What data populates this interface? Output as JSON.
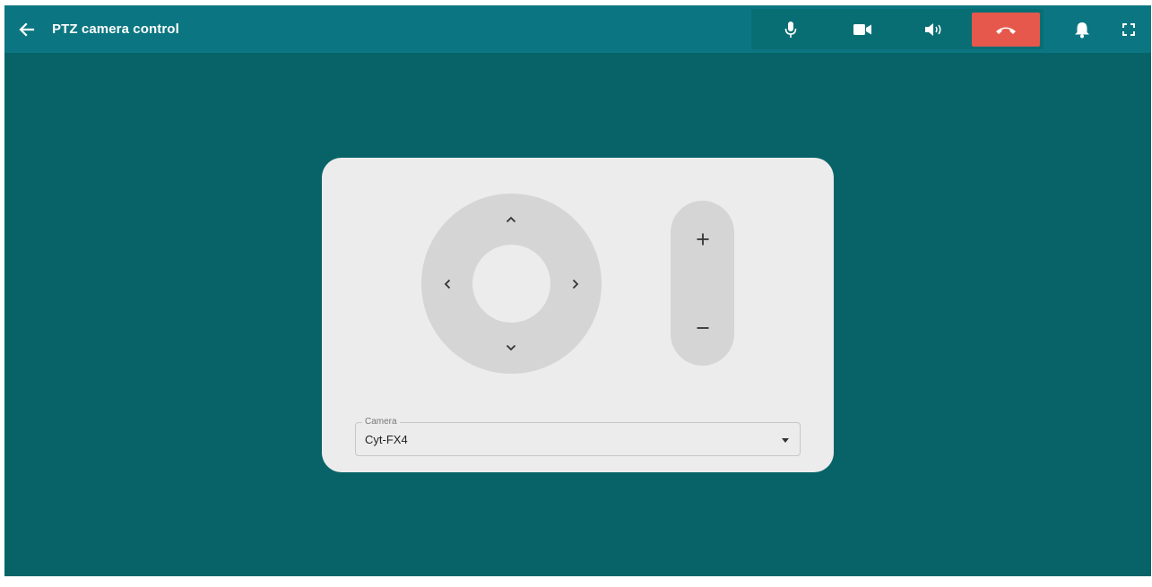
{
  "header": {
    "title": "PTZ camera control",
    "back_icon": "arrow-left-icon"
  },
  "call_controls": {
    "items": [
      {
        "name": "microphone",
        "icon": "microphone-icon"
      },
      {
        "name": "camera",
        "icon": "video-camera-icon"
      },
      {
        "name": "speaker",
        "icon": "speaker-icon"
      },
      {
        "name": "hang-up",
        "icon": "phone-hangup-icon",
        "color": "#e5584b"
      }
    ]
  },
  "toolbar_right": {
    "items": [
      {
        "name": "notifications",
        "icon": "bell-icon"
      },
      {
        "name": "fullscreen",
        "icon": "fullscreen-icon"
      }
    ]
  },
  "ptz": {
    "pan_tilt_icons": [
      "chevron-up-icon",
      "chevron-left-icon",
      "chevron-right-icon",
      "chevron-down-icon"
    ],
    "zoom_in_label": "+",
    "zoom_out_label": "−"
  },
  "camera_select": {
    "label": "Camera",
    "value": "Cyt-FX4"
  },
  "colors": {
    "header": "#0b7681",
    "background": "#076368",
    "panel": "#ececec",
    "control": "#d5d5d5",
    "hangup": "#e5584b"
  }
}
